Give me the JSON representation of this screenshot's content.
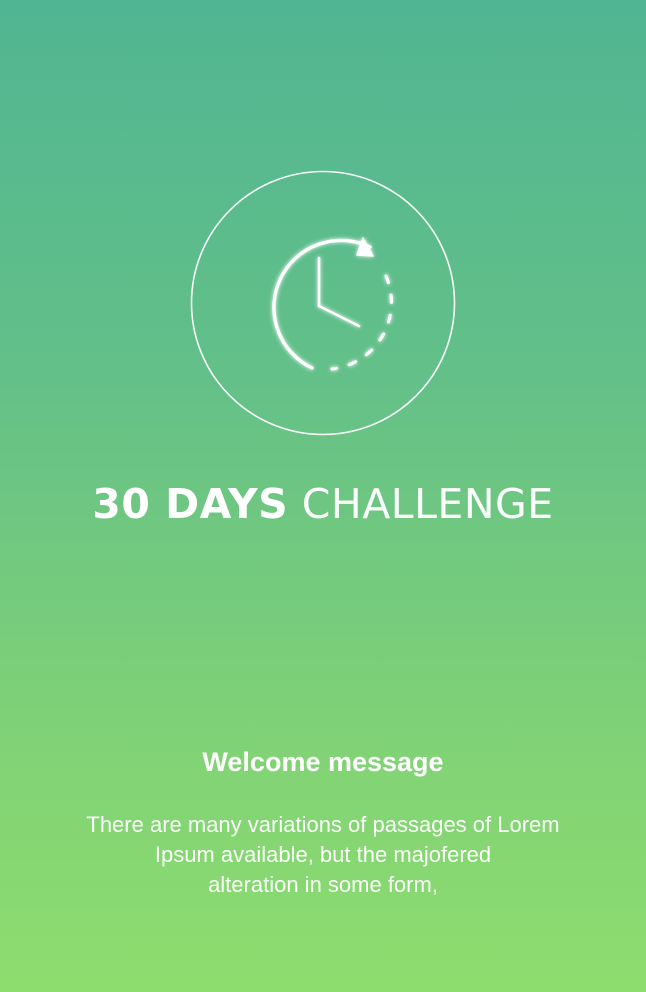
{
  "app": {
    "title_bold": "30 DAYS",
    "title_light": "CHALLENGE",
    "logo_icon": "clock-refresh-icon"
  },
  "welcome": {
    "heading": "Welcome message",
    "body_lines": [
      "There are many variations of passages of Lorem",
      "Ipsum available, but the majofered",
      "alteration in some form,"
    ]
  },
  "colors": {
    "gradient_top": "#50b592",
    "gradient_bottom": "#8ddd6e",
    "foreground": "#ffffff"
  }
}
